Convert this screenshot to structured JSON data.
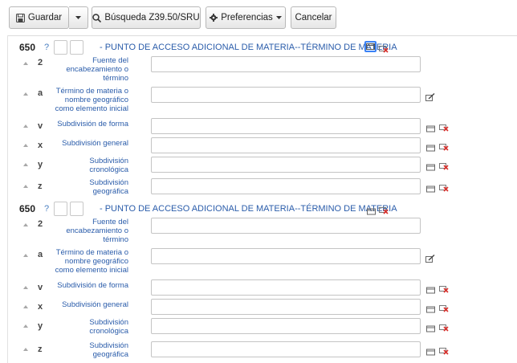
{
  "toolbar": {
    "save_label": "Guardar",
    "search_label": "Búsqueda Z39.50/SRU",
    "preferences_label": "Preferencias",
    "cancel_label": "Cancelar"
  },
  "fields": [
    {
      "tag": "650",
      "help": "?",
      "title": "- PUNTO DE ACCESO ADICIONAL DE MATERIA--TÉRMINO DE MATERIA",
      "subfields": [
        {
          "code": "2",
          "label": [
            "Fuente del",
            "encabezamiento o",
            "término"
          ]
        },
        {
          "code": "a",
          "label": [
            "Término de materia o",
            "nombre geográfico",
            "como elemento inicial"
          ]
        },
        {
          "code": "v",
          "label": [
            "Subdivisión de forma"
          ]
        },
        {
          "code": "x",
          "label": [
            "Subdivisión general"
          ]
        },
        {
          "code": "y",
          "label": [
            "Subdivisión",
            "cronológica"
          ]
        },
        {
          "code": "z",
          "label": [
            "Subdivisión",
            "geográfica"
          ]
        }
      ]
    },
    {
      "tag": "650",
      "help": "?",
      "title": "- PUNTO DE ACCESO ADICIONAL DE MATERIA--TÉRMINO DE MATERIA",
      "subfields": [
        {
          "code": "2",
          "label": [
            "Fuente del",
            "encabezamiento o",
            "término"
          ]
        },
        {
          "code": "a",
          "label": [
            "Término de materia o",
            "nombre geográfico",
            "como elemento inicial"
          ]
        },
        {
          "code": "v",
          "label": [
            "Subdivisión de forma"
          ]
        },
        {
          "code": "x",
          "label": [
            "Subdivisión general"
          ]
        },
        {
          "code": "y",
          "label": [
            "Subdivisión",
            "cronológica"
          ]
        },
        {
          "code": "z",
          "label": [
            "Subdivisión",
            "geográfica"
          ]
        }
      ]
    }
  ],
  "colors": {
    "link": "#2a5caa",
    "help": "#4a7fc1",
    "delete": "#d9302c",
    "focus": "#3b82f6"
  },
  "icons": [
    "save-icon",
    "caret-down-icon",
    "search-icon",
    "gear-icon",
    "repeat-field-icon",
    "delete-icon",
    "edit-icon"
  ]
}
